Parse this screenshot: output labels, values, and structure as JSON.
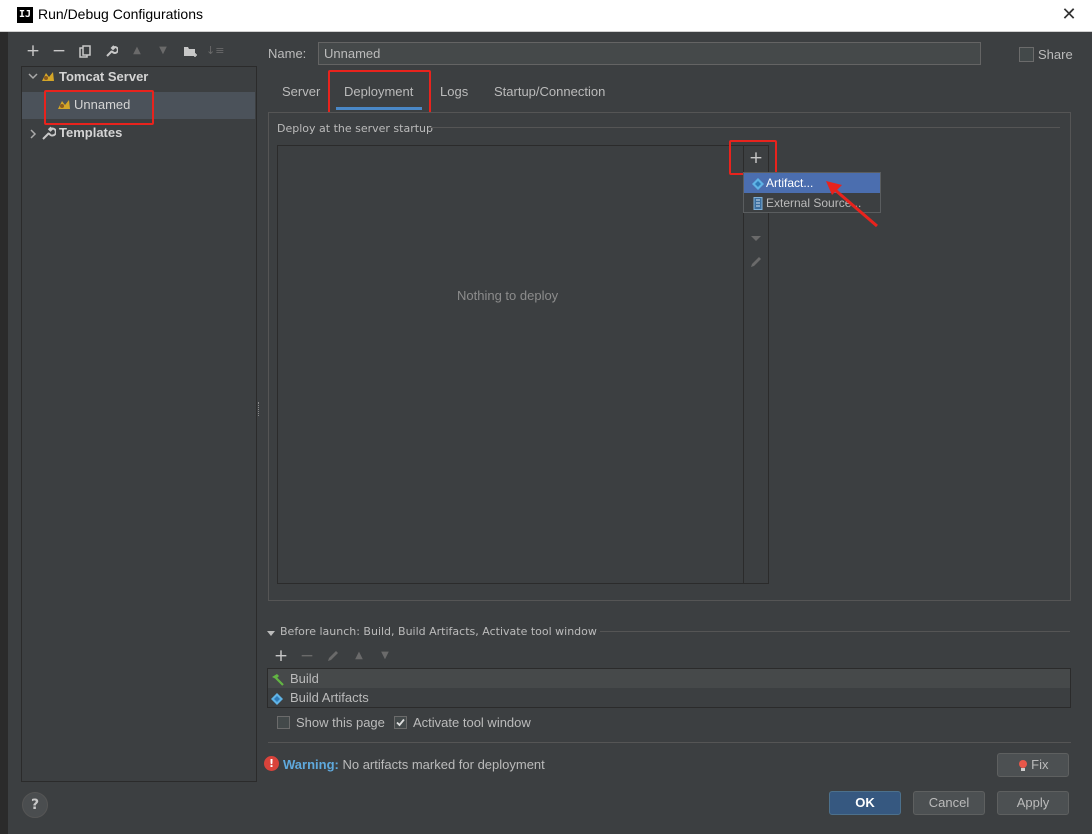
{
  "window": {
    "title": "Run/Debug Configurations",
    "app_icon": "IJ",
    "close": "✕"
  },
  "toolbar": {
    "add": "+",
    "remove": "−",
    "copy": "⧉",
    "edit": "🔧",
    "up": "▲",
    "down": "▼",
    "folder": "▣",
    "sort": "↓≡"
  },
  "tree": {
    "tomcat": "Tomcat Server",
    "unnamed": "Unnamed",
    "templates": "Templates"
  },
  "name_field": {
    "label": "Name:",
    "value": "Unnamed"
  },
  "share": {
    "label": "Share"
  },
  "tabs": [
    {
      "label": "Server"
    },
    {
      "label": "Deployment"
    },
    {
      "label": "Logs"
    },
    {
      "label": "Startup/Connection"
    }
  ],
  "deploy": {
    "group_label": "Deploy at the server startup",
    "empty": "Nothing to deploy",
    "add": "+"
  },
  "popup": {
    "artifact": "Artifact...",
    "external": "External Source..."
  },
  "before_launch": {
    "title": "Before launch: Build, Build Artifacts, Activate tool window",
    "items": [
      "Build",
      "Build Artifacts"
    ],
    "show_page": "Show this page",
    "activate": "Activate tool window"
  },
  "warning": {
    "label": "Warning:",
    "text": "No artifacts marked for deployment"
  },
  "buttons": {
    "fix": "Fix",
    "ok": "OK",
    "cancel": "Cancel",
    "apply": "Apply",
    "help": "?"
  },
  "colors": {
    "accent": "#4a88c7",
    "highlight_red": "#e8231d",
    "selection": "#4b6eaf"
  }
}
